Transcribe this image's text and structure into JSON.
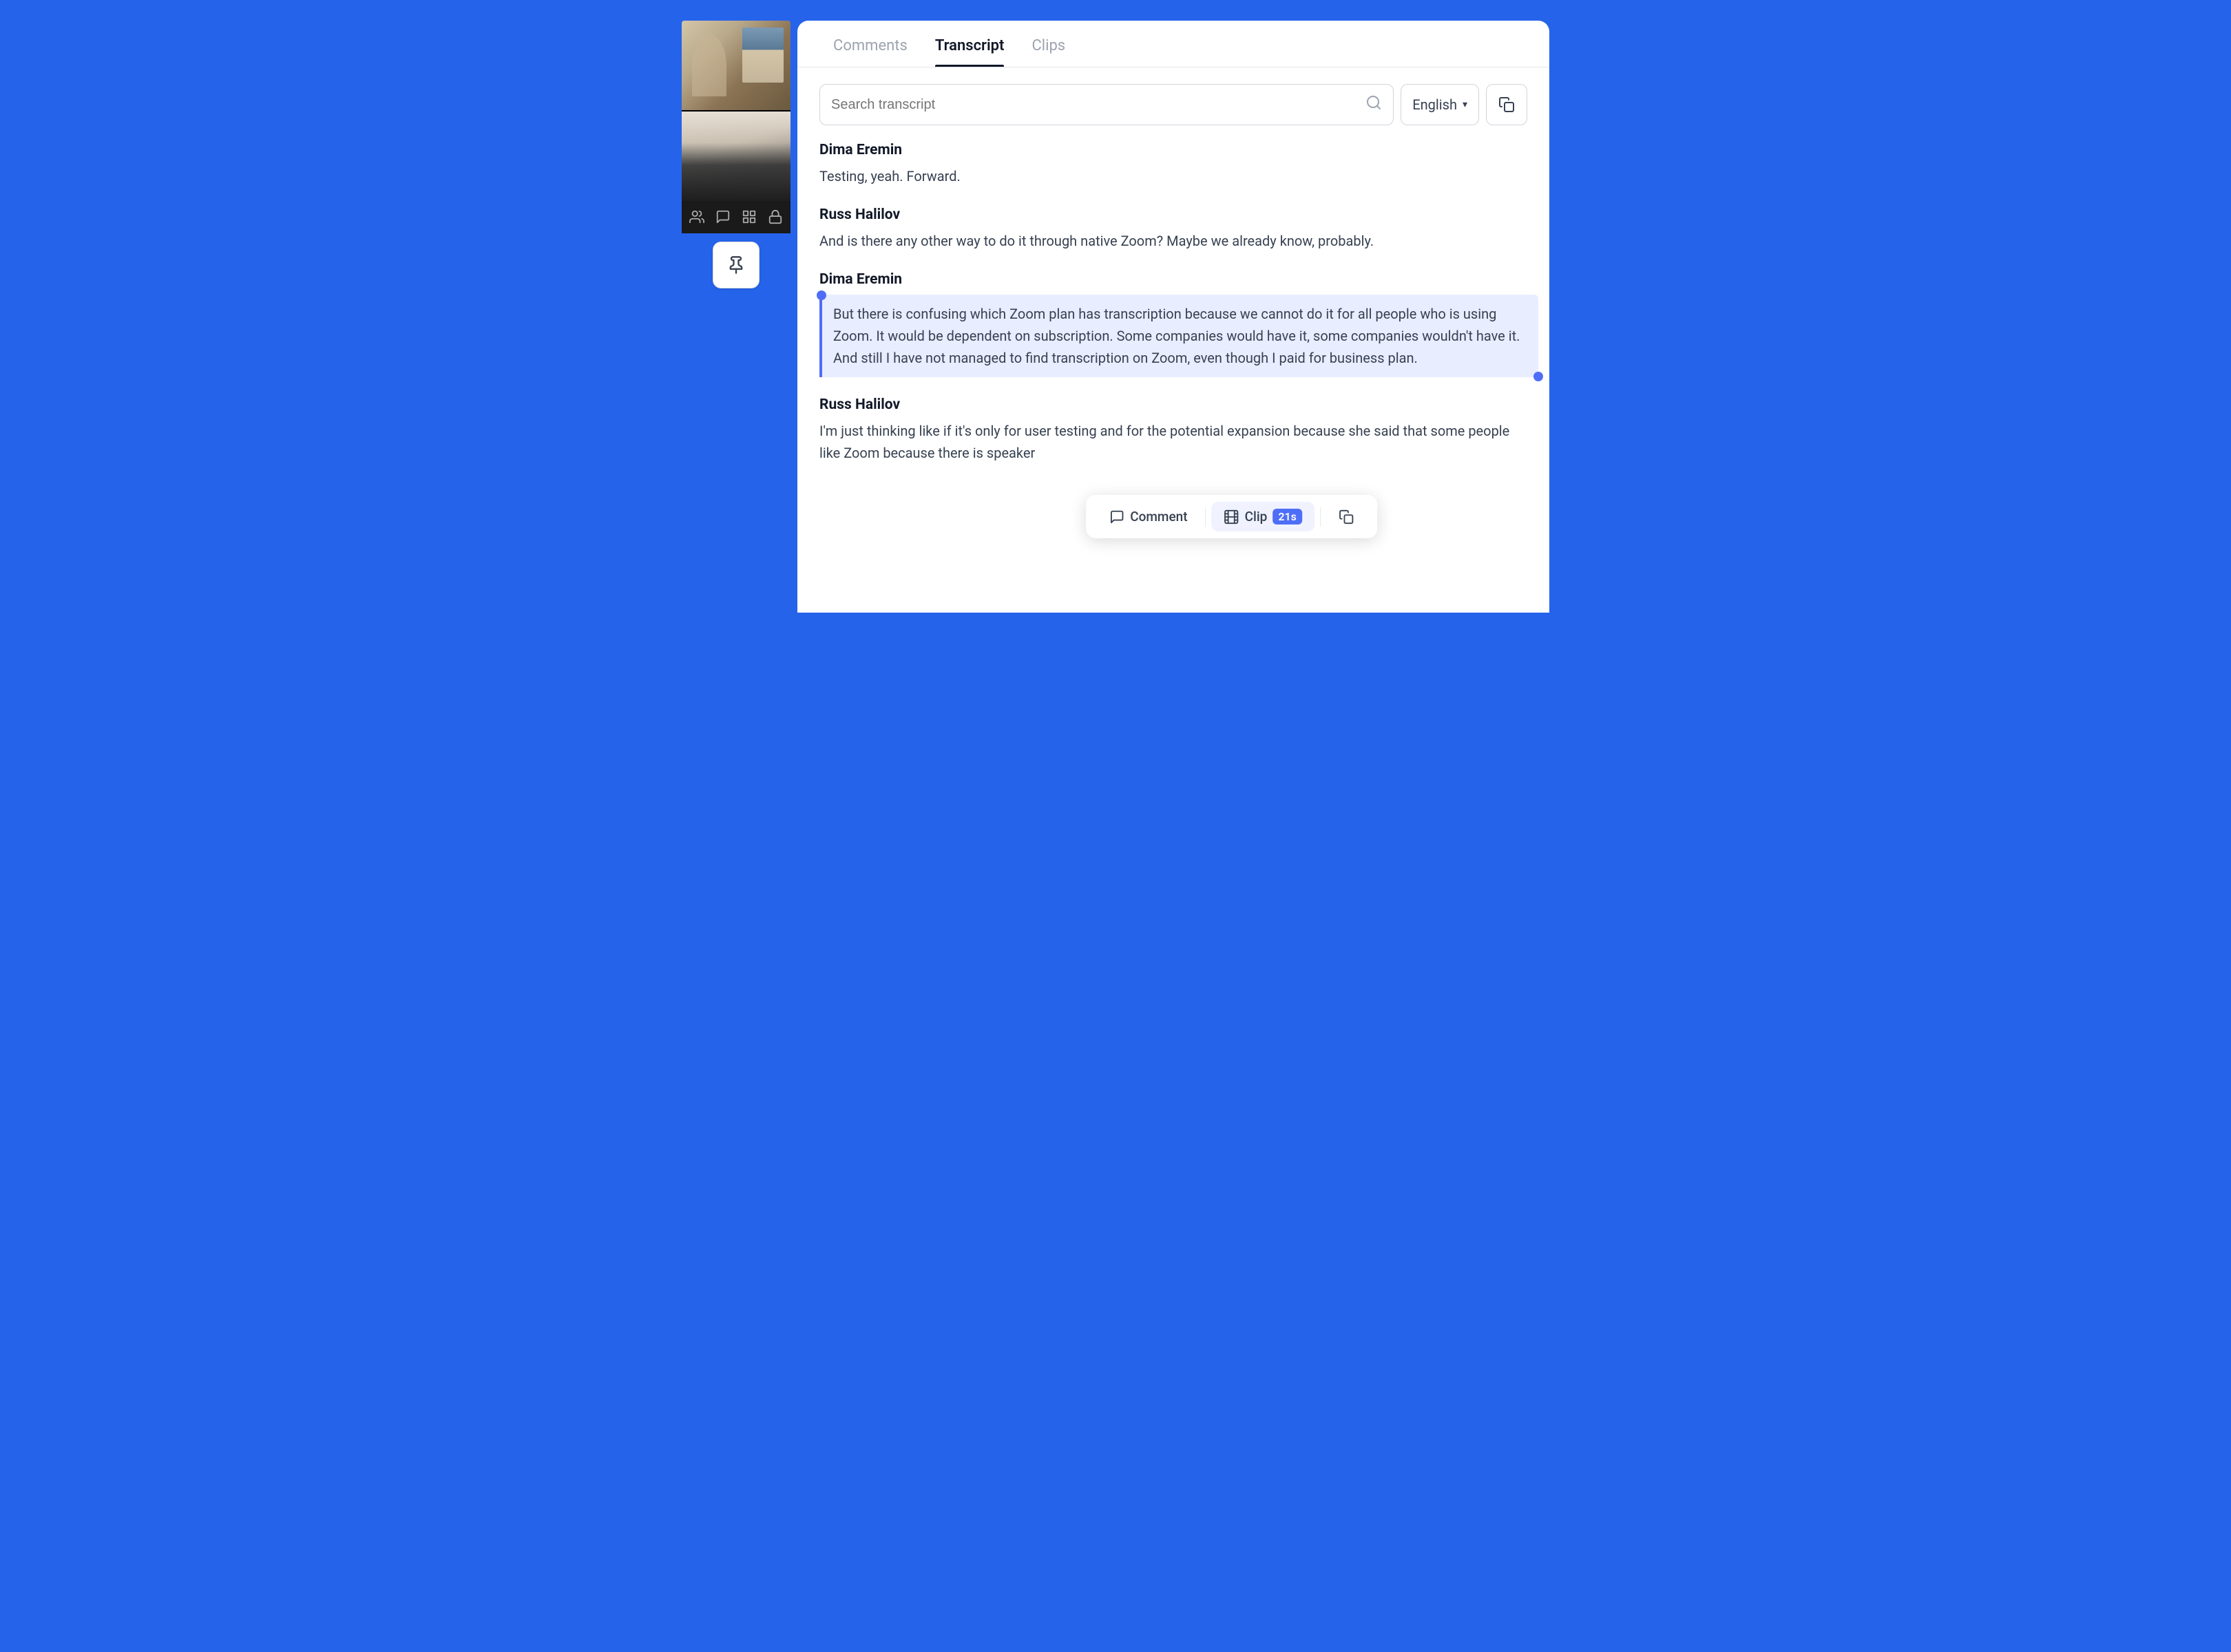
{
  "background_color": "#2563eb",
  "tabs": {
    "items": [
      {
        "id": "comments",
        "label": "Comments",
        "active": false
      },
      {
        "id": "transcript",
        "label": "Transcript",
        "active": true
      },
      {
        "id": "clips",
        "label": "Clips",
        "active": false
      }
    ]
  },
  "search": {
    "placeholder": "Search transcript",
    "value": ""
  },
  "language": {
    "label": "English",
    "chevron": "▾"
  },
  "transcript": {
    "entries": [
      {
        "id": "entry-1",
        "speaker": "Dima Eremin",
        "text": "Testing, yeah. Forward.",
        "highlighted": false
      },
      {
        "id": "entry-2",
        "speaker": "Russ Halilov",
        "text": "And is there any other way to do it through native Zoom? Maybe we already know, probably.",
        "highlighted": false
      },
      {
        "id": "entry-3",
        "speaker": "Dima Eremin",
        "text": "But there is confusing which Zoom plan has transcription because we cannot do it for all people who is using Zoom. It would be dependent on subscription. Some companies would have it, some companies wouldn't have it. And still I have not managed to find transcription on Zoom, even though I paid for business plan.",
        "highlighted": true
      },
      {
        "id": "entry-4",
        "speaker": "Russ Halilov",
        "text": "I'm just thinking like if it's only for user testing and for the potential expansion because she said that some people like Zoom because there is speaker",
        "highlighted": false,
        "partial": true
      }
    ]
  },
  "action_bar": {
    "comment_label": "Comment",
    "clip_label": "Clip",
    "clip_duration": "21s",
    "copy_tooltip": "Copy"
  },
  "icons": {
    "search": "⌕",
    "copy": "⧉",
    "pin": "📌",
    "users": "👥",
    "chat": "💬",
    "diagram": "⬡",
    "lock": "🔒",
    "comment_bubble": "💬",
    "clip_icon": "⏱"
  }
}
